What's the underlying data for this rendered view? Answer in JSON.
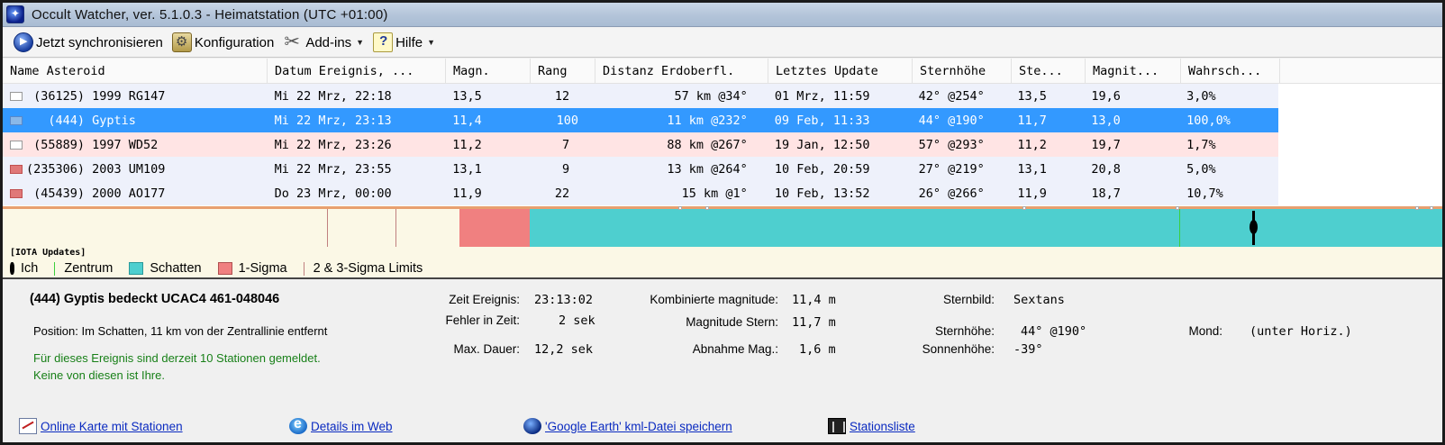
{
  "window": {
    "title": "Occult Watcher, ver. 5.1.0.3 - Heimatstation (UTC +01:00)"
  },
  "toolbar": {
    "sync_label": "Jetzt synchronisieren",
    "config_label": "Konfiguration",
    "addins_label": "Add-ins",
    "help_label": "Hilfe"
  },
  "grid": {
    "headers": [
      "Name Asteroid",
      "Datum Ereignis, ...",
      "Magn.",
      "Rang",
      "Distanz Erdoberfl.",
      "Letztes Update",
      "Sternhöhe",
      "Ste...",
      "Magnit...",
      "Wahrsch..."
    ],
    "rows": [
      {
        "name": " (36125) 1999 RG147",
        "date": "Mi 22 Mrz, 22:18",
        "magn": "13,5",
        "rang": "12",
        "dist": "57 km @34°",
        "update": "01 Mrz, 11:59",
        "alt": "42° @254°",
        "ste": "13,5",
        "magnit": "19,6",
        "prob": "3,0%"
      },
      {
        "name": "   (444) Gyptis",
        "date": "Mi 22 Mrz, 23:13",
        "magn": "11,4",
        "rang": "100",
        "dist": "11 km @232°",
        "update": "09 Feb, 11:33",
        "alt": "44° @190°",
        "ste": "11,7",
        "magnit": "13,0",
        "prob": "100,0%"
      },
      {
        "name": " (55889) 1997 WD52",
        "date": "Mi 22 Mrz, 23:26",
        "magn": "11,2",
        "rang": "7",
        "dist": "88 km @267°",
        "update": "19 Jan, 12:50",
        "alt": "57° @293°",
        "ste": "11,2",
        "magnit": "19,7",
        "prob": "1,7%"
      },
      {
        "name": "(235306) 2003 UM109",
        "date": "Mi 22 Mrz, 23:55",
        "magn": "13,1",
        "rang": "9",
        "dist": "13 km @264°",
        "update": "10 Feb, 20:59",
        "alt": "27° @219°",
        "ste": "13,1",
        "magnit": "20,8",
        "prob": "5,0%"
      },
      {
        "name": " (45439) 2000 AO177",
        "date": "Do 23 Mrz, 00:00",
        "magn": "11,9",
        "rang": "22",
        "dist": "15 km @1°",
        "update": "10 Feb, 13:52",
        "alt": "26° @266°",
        "ste": "11,9",
        "magnit": "18,7",
        "prob": "10,7%"
      }
    ]
  },
  "timeline": {
    "source_label": "[IOTA Updates]"
  },
  "legend": {
    "me": "Ich",
    "center": "Zentrum",
    "shadow": "Schatten",
    "sigma1": "1-Sigma",
    "limits": "2 & 3-Sigma Limits"
  },
  "details": {
    "title": "(444) Gyptis bedeckt UCAC4 461-048046",
    "position": "Position:  Im Schatten, 11 km von der Zentrallinie entfernt",
    "stations_line1": "Für dieses Ereignis sind derzeit 10 Stationen gemeldet.",
    "stations_line2": "Keine von diesen ist Ihre.",
    "event_time_label": "Zeit Ereignis:",
    "event_time": "23:13:02",
    "time_error_label": "Fehler in Zeit:",
    "time_error": "2 sek",
    "max_duration_label": "Max. Dauer:",
    "max_duration": "12,2 sek",
    "comb_mag_label": "Kombinierte magnitude:",
    "comb_mag": "11,4 m",
    "star_mag_label": "Magnitude Stern:",
    "star_mag": "11,7 m",
    "mag_drop_label": "Abnahme Mag.:",
    "mag_drop": "1,6 m",
    "constellation_label": "Sternbild:",
    "constellation": "Sextans",
    "star_alt_label": "Sternhöhe:",
    "star_alt": "44° @190°",
    "sun_alt_label": "Sonnenhöhe:",
    "sun_alt": "-39°",
    "moon_label": "Mond:",
    "moon": "(unter Horiz.)"
  },
  "links": {
    "map": "Online Karte mit Stationen",
    "web": "Details im Web",
    "kml": "'Google Earth' kml-Datei speichern",
    "stations": "Stationsliste"
  }
}
